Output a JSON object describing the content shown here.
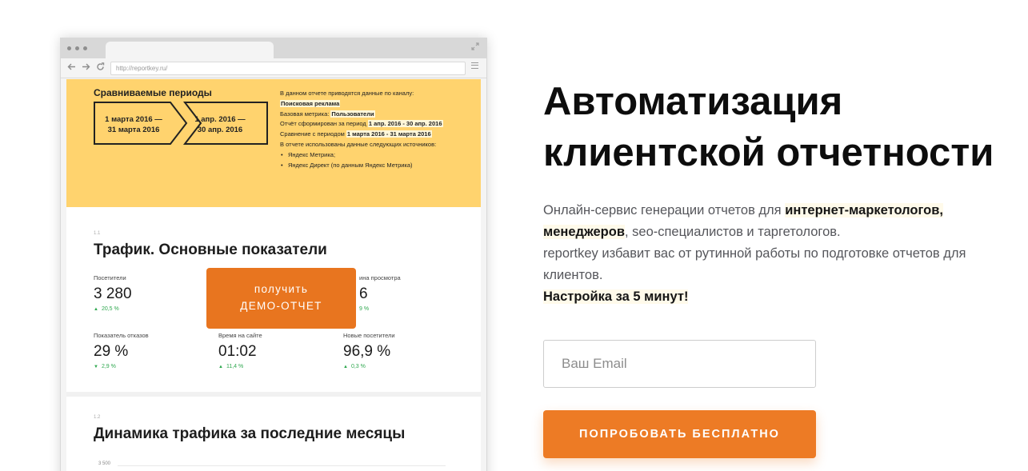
{
  "browser": {
    "url": "http://reportkey.ru/"
  },
  "report": {
    "compare_title": "Сравниваемые периоды",
    "period_a": [
      "1 марта 2016 —",
      "31 марта 2016"
    ],
    "period_b": [
      "1 апр. 2016 —",
      "30 апр. 2016"
    ],
    "info": {
      "line1": "В данном отчете приводятся данные по каналу:",
      "channel": "Поисковая реклама",
      "base_prefix": "Базовая метрика: ",
      "base_value": "Пользователи",
      "formed_prefix": "Отчёт сформирован за период ",
      "formed_value": "1 апр. 2016 - 30 апр. 2016",
      "compare_prefix": "Сравнение с периодом ",
      "compare_value": "1 марта 2016 - 31 марта 2016",
      "sources_intro": "В отчете использованы данные следующих источников:",
      "sources": [
        "Яндекс Метрика;",
        "Яндекс Директ (по данным Яндекс Метрика)"
      ]
    },
    "section1": {
      "number": "1.1",
      "title": "Трафик. Основные показатели",
      "metrics": [
        {
          "label": "Посетители",
          "value": "3 280",
          "delta": "20,5 %",
          "dir": "up"
        },
        {
          "label": "ина просмотра",
          "value": "6",
          "delta": "9 %",
          "dir": "up"
        },
        {
          "label": "Показатель отказов",
          "value": "29 %",
          "delta": "2,9 %",
          "dir": "down"
        },
        {
          "label": "Время на сайте",
          "value": "01:02",
          "delta": "11,4 %",
          "dir": "up"
        },
        {
          "label": "Новые посетители",
          "value": "96,9 %",
          "delta": "0,3 %",
          "dir": "up"
        }
      ]
    },
    "demo_button": [
      "получить",
      "ДЕМО-ОТЧЕТ"
    ],
    "section2": {
      "number": "1.2",
      "title": "Динамика трафика за последние месяцы",
      "first_tick": "3 500"
    }
  },
  "hero": {
    "title_lines": [
      "Автоматизация",
      "клиентской отчетности"
    ],
    "desc_p1": "Онлайн-сервис генерации отчетов для ",
    "desc_bold1": "интернет-маркетологов,",
    "desc_bold2": "менеджеров",
    "desc_p2": ", seo-специалистов и таргетологов.",
    "desc_p3": "reportkey избавит вас от рутинной работы по подготовке отчетов для клиентов.",
    "desc_bold3": "Настройка за 5 минут!",
    "email_placeholder": "Ваш Email",
    "cta_label": "ПОПРОБОВАТЬ БЕСПЛАТНО"
  },
  "colors": {
    "accent_orange": "#ed7b25",
    "report_yellow": "#ffd36e",
    "delta_green": "#2fa84f"
  },
  "icons": {
    "back": "arrow-left-icon",
    "forward": "arrow-right-icon",
    "reload": "reload-icon",
    "menu": "hamburger-icon",
    "expand": "expand-icon"
  }
}
